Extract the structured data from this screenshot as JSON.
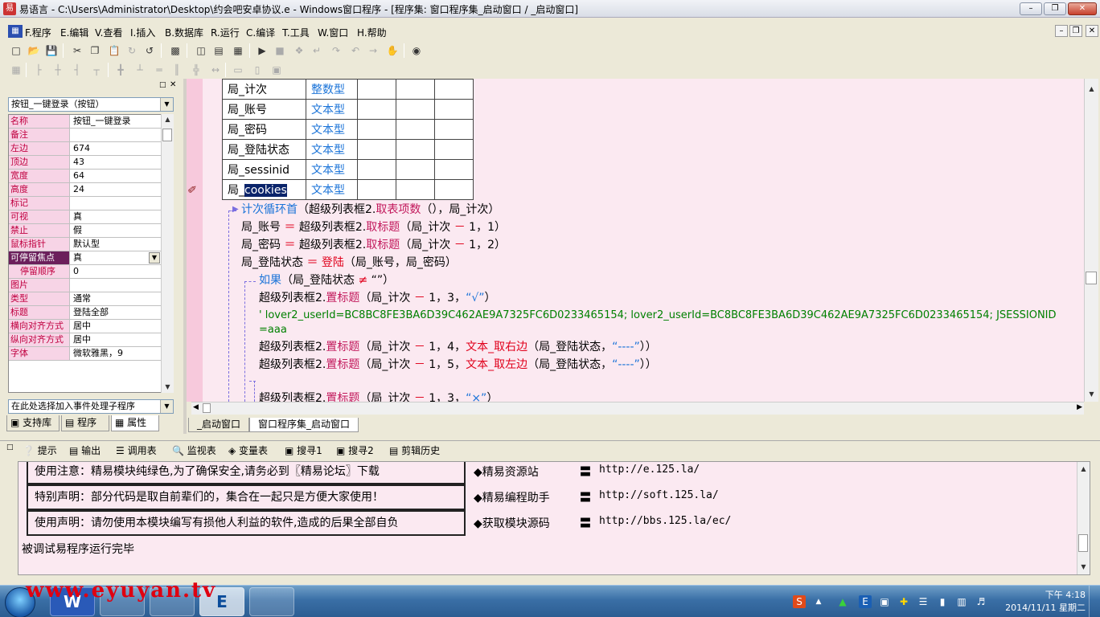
{
  "window": {
    "title": "易语言 - C:\\Users\\Administrator\\Desktop\\约会吧安卓协议.e - Windows窗口程序 - [程序集: 窗口程序集_启动窗口 / _启动窗口]",
    "app_icon": "易",
    "minimize": "0",
    "restore": "1",
    "close": "r"
  },
  "menu": [
    "F.程序",
    "E.编辑",
    "V.查看",
    "I.插入",
    "B.数据库",
    "R.运行",
    "C.编译",
    "T.工具",
    "W.窗口",
    "H.帮助"
  ],
  "left_panel": {
    "object_combo": "按钮_一键登录（按钮）",
    "properties": [
      {
        "name": "名称",
        "value": "按钮_一键登录"
      },
      {
        "name": "备注",
        "value": ""
      },
      {
        "name": "左边",
        "value": "674"
      },
      {
        "name": "顶边",
        "value": "43"
      },
      {
        "name": "宽度",
        "value": "64"
      },
      {
        "name": "高度",
        "value": "24"
      },
      {
        "name": "标记",
        "value": ""
      },
      {
        "name": "可视",
        "value": "真"
      },
      {
        "name": "禁止",
        "value": "假"
      },
      {
        "name": "鼠标指针",
        "value": "默认型"
      },
      {
        "name": "可停留焦点",
        "value": "真"
      },
      {
        "name": "停留顺序",
        "value": "0"
      },
      {
        "name": "图片",
        "value": ""
      },
      {
        "name": "类型",
        "value": "通常"
      },
      {
        "name": "标题",
        "value": "登陆全部"
      },
      {
        "name": "横向对齐方式",
        "value": "居中"
      },
      {
        "name": "纵向对齐方式",
        "value": "居中"
      },
      {
        "name": "字体",
        "value": "微软雅黑，9"
      }
    ],
    "event_combo": "在此处选择加入事件处理子程序",
    "tabs": [
      "支持库",
      "程序",
      "属性"
    ]
  },
  "editor": {
    "variables": [
      {
        "name": "局_计次",
        "type": "整数型"
      },
      {
        "name": "局_账号",
        "type": "文本型"
      },
      {
        "name": "局_密码",
        "type": "文本型"
      },
      {
        "name": "局_登陆状态",
        "type": "文本型"
      },
      {
        "name": "局_sessinid",
        "type": "文本型"
      },
      {
        "name_prefix": "局_",
        "name_sel": "cookies",
        "type": "文本型"
      }
    ],
    "code": {
      "l1_kw": "计次循环首",
      "l1_a": "（超级列表框2.",
      "l1_fn": "取表项数",
      "l1_b": "（），局_计次）",
      "l2_a": "局_账号 ",
      "l2_op": "＝",
      "l2_b": " 超级列表框2.",
      "l2_fn": "取标题",
      "l2_c": "（局_计次 ",
      "l2_op2": "－",
      "l2_d": " 1，1）",
      "l3_a": "局_密码 ",
      "l3_op": "＝",
      "l3_b": " 超级列表框2.",
      "l3_fn": "取标题",
      "l3_c": "（局_计次 ",
      "l3_op2": "－",
      "l3_d": " 1，2）",
      "l4_a": "局_登陆状态 ",
      "l4_op": "＝",
      "l4_fn": " 登陆",
      "l4_b": "（局_账号，局_密码）",
      "l5_kw": "如果",
      "l5_a": "（局_登陆状态 ",
      "l5_op": "≠",
      "l5_b": " “”）",
      "l6_a": "超级列表框2.",
      "l6_fn": "置标题",
      "l6_b": "（局_计次 ",
      "l6_op": "－",
      "l6_c": " 1，3，",
      "l6_st": "“√”",
      "l6_d": "）",
      "comment1": "' lover2_userId=BC8BC8FE3BA6D39C462AE9A7325FC6D0233465154; lover2_userId=BC8BC8FE3BA6D39C462AE9A7325FC6D0233465154; JSESSIONID",
      "comment2": "=aaa",
      "l8_a": "超级列表框2.",
      "l8_fn": "置标题",
      "l8_b": "（局_计次 ",
      "l8_op": "－",
      "l8_c": " 1，4，",
      "l8_fn2": "文本_取右边",
      "l8_d": "（局_登陆状态，",
      "l8_st": "“----”",
      "l8_e": "））",
      "l9_a": "超级列表框2.",
      "l9_fn": "置标题",
      "l9_b": "（局_计次 ",
      "l9_op": "－",
      "l9_c": " 1，5，",
      "l9_fn2": "文本_取左边",
      "l9_d": "（局_登陆状态，",
      "l9_st": "“----”",
      "l9_e": "））",
      "l10_a": "超级列表框2.",
      "l10_fn": "置标题",
      "l10_b": "（局_计次 ",
      "l10_op": "－",
      "l10_c": " 1，3，",
      "l10_st": "“×”",
      "l10_d": "）"
    },
    "tabs": [
      "_启动窗口",
      "窗口程序集_启动窗口"
    ]
  },
  "bottom_tabs": [
    "提示",
    "输出",
    "调用表",
    "监视表",
    "变量表",
    "搜寻1",
    "搜寻2",
    "剪辑历史"
  ],
  "output": {
    "notes": [
      "使用注意：精易模块纯绿色,为了确保安全,请务必到〖精易论坛〗下载",
      "特别声明：部分代码是取自前辈们的，集合在一起只是方便大家使用！",
      "使用声明：请勿使用本模块编写有损他人利益的软件,造成的后果全部自负"
    ],
    "links": [
      {
        "label": "◆精易资源站",
        "eq": "〓",
        "url": "http://e.125.la/"
      },
      {
        "label": "◆精易编程助手",
        "eq": "〓",
        "url": "http://soft.125.la/"
      },
      {
        "label": "◆获取模块源码",
        "eq": "〓",
        "url": "http://bbs.125.la/ec/"
      }
    ],
    "status": "被调试易程序运行完毕"
  },
  "taskbar": {
    "watermark": "www.eyuyan.tv",
    "apps": [
      "W",
      "",
      "",
      "E",
      ""
    ],
    "time": "下午 4:18",
    "date": "2014/11/11 星期二"
  }
}
